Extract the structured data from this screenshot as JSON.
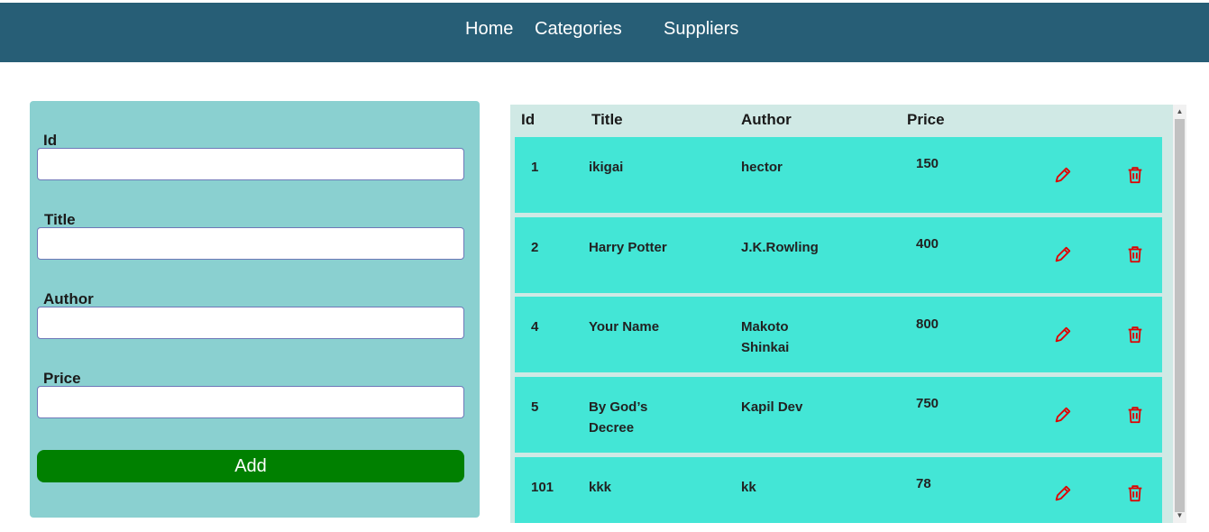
{
  "nav": {
    "home": "Home",
    "categories": "Categories",
    "suppliers": "Suppliers"
  },
  "form": {
    "fields": [
      {
        "label": "Id",
        "value": ""
      },
      {
        "label": "Title",
        "value": ""
      },
      {
        "label": "Author",
        "value": ""
      },
      {
        "label": "Price",
        "value": ""
      }
    ],
    "add_label": "Add"
  },
  "table": {
    "headers": [
      "Id",
      "Title",
      "Author",
      "Price"
    ],
    "rows": [
      {
        "id": "1",
        "title": "ikigai",
        "author": "hector",
        "price": "150"
      },
      {
        "id": "2",
        "title": "Harry Potter",
        "author": "J.K.Rowling",
        "price": "400"
      },
      {
        "id": "4",
        "title": "Your Name",
        "author": "Makoto Shinkai",
        "price": "800"
      },
      {
        "id": "5",
        "title": "By God’s Decree",
        "author": "Kapil Dev",
        "price": "750"
      },
      {
        "id": "101",
        "title": "kkk",
        "author": "kk",
        "price": "78"
      }
    ],
    "icons": {
      "edit": "pencil-icon",
      "delete": "trash-icon"
    }
  },
  "colors": {
    "navbar": "#275e76",
    "form_panel": "#8ad0d0",
    "add_button": "#008000",
    "table_header": "#d0e9e5",
    "row": "#43e6d6",
    "action_icon": "#e00000"
  }
}
